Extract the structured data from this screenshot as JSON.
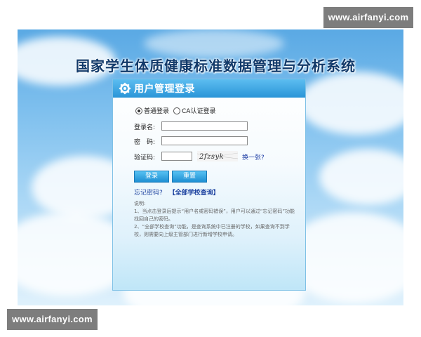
{
  "watermark": {
    "top": "www.airfanyi.com",
    "bottom": "www.airfanyi.com"
  },
  "system_title": "国家学生体质健康标准数据管理与分析系统",
  "panel": {
    "title": "用户管理登录",
    "login_modes": [
      {
        "label": "普通登录",
        "checked": true
      },
      {
        "label": "CA认证登录",
        "checked": false
      }
    ],
    "username_label": "登录名:",
    "password_label": "密　码:",
    "captcha_label": "验证码:",
    "captcha_text": "2fzsyk",
    "refresh_link": "换一张?",
    "login_button": "登录",
    "reset_button": "重置",
    "forgot_link": "忘记密码?",
    "school_query_link": "【全部学校查询】",
    "notes_title": "说明:",
    "notes": [
      "1、当点击登录后提示“用户名或密码错误”，用户可以通过“忘记密码”功能找回自己的密码。",
      "2、“全部学校查询”功能，是查询系统中已注册的学校，如果查询不到学校，则需要向上级主管部门进行新增学校申请。"
    ]
  },
  "colors": {
    "header_blue": "#2a95d8",
    "link_blue": "#1a3f9e",
    "title_navy": "#123a6a"
  }
}
